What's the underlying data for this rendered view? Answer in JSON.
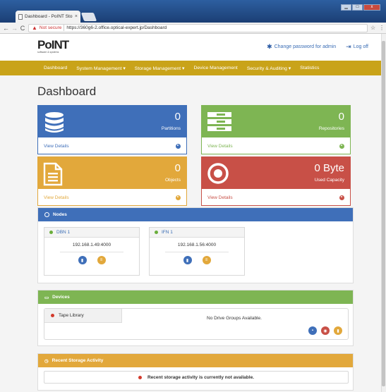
{
  "browser": {
    "tab_title": "Dashboard - PoINT Stora",
    "tab_close": "×",
    "not_secure": "Not secure",
    "url": "https://360g6-2.office.optical-expert.jp/Dashboard",
    "back": "←",
    "forward": "→",
    "reload": "C",
    "star": "☆",
    "menu": "⋮",
    "win_min": "▁",
    "win_max": "□",
    "win_close": "x"
  },
  "header": {
    "logo_text": "PoINT",
    "logo_sub": "software & systems",
    "change_password": "Change password for admin",
    "logout": "Log off"
  },
  "nav": [
    "Dashboard",
    "System Management ▾",
    "Storage Management ▾",
    "Device Management",
    "Security & Auditing ▾",
    "Statistics"
  ],
  "page_title": "Dashboard",
  "cards": [
    {
      "value": "0",
      "label": "Partitions",
      "link": "View Details",
      "color": "#3f6fb9"
    },
    {
      "value": "0",
      "label": "Repositories",
      "link": "View Details",
      "color": "#7eb553"
    },
    {
      "value": "0",
      "label": "Objects",
      "link": "View Details",
      "color": "#e2a83b"
    },
    {
      "value": "0 Byte",
      "label": "Used Capacity",
      "link": "View Details",
      "color": "#c85047"
    }
  ],
  "nodes_panel": {
    "title": "Nodes",
    "color": "#3f6fb9",
    "nodes": [
      {
        "name": "DBN 1",
        "ip": "192.168.1.49:4000"
      },
      {
        "name": "IFN 1",
        "ip": "192.168.1.56:4000"
      }
    ]
  },
  "devices_panel": {
    "title": "Devices",
    "color": "#7eb553",
    "device": "Tape Library",
    "empty": "No Drive Groups Available."
  },
  "activity_panel": {
    "title": "Recent Storage Activity",
    "color": "#e2a83b",
    "empty": "Recent storage activity is currently not available."
  }
}
